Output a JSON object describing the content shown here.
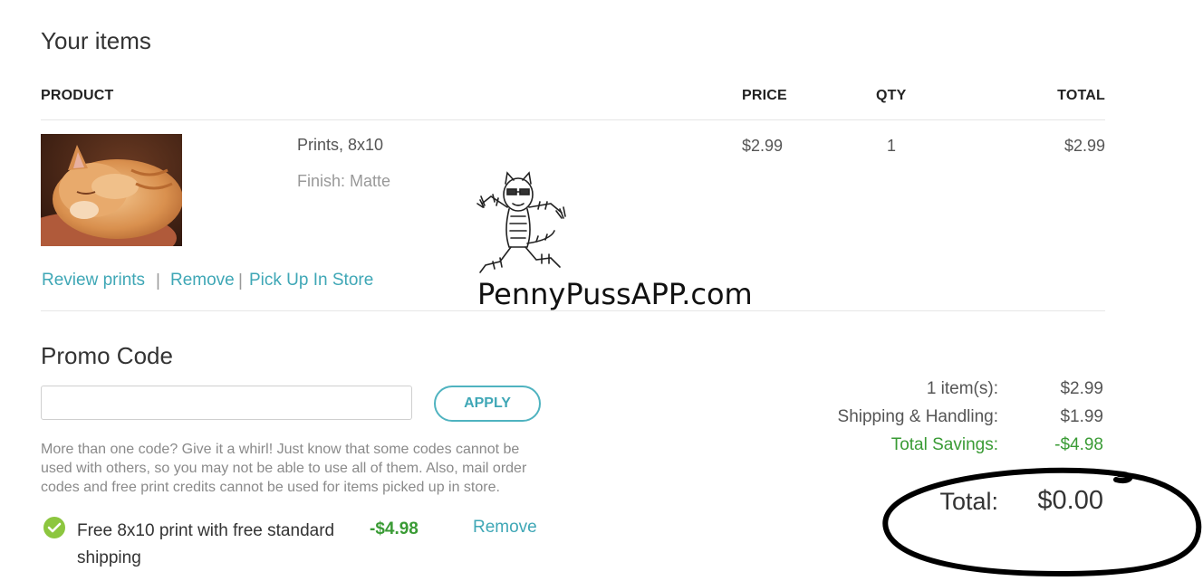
{
  "cart": {
    "title": "Your items",
    "columns": {
      "product": "PRODUCT",
      "price": "PRICE",
      "qty": "QTY",
      "total": "TOTAL"
    },
    "items": [
      {
        "name": "Prints, 8x10",
        "finish": "Finish: Matte",
        "price": "$2.99",
        "qty": "1",
        "total": "$2.99",
        "thumbnail": "orange-cat-photo"
      }
    ],
    "actions": {
      "review": "Review prints",
      "remove": "Remove",
      "pickup": "Pick Up In Store",
      "separator": "|"
    }
  },
  "watermark": {
    "text": "PennyPussAPP.com"
  },
  "promo": {
    "title": "Promo Code",
    "input_value": "",
    "input_placeholder": "",
    "apply_label": "APPLY",
    "note": "More than one code? Give it a whirl! Just know that some codes cannot be used with others, so you may not be able to use all of them. Also, mail order codes and free print credits cannot be used for items picked up in store.",
    "applied": [
      {
        "label": "Free 8x10 print with free standard shipping",
        "amount": "-$4.98",
        "remove_label": "Remove"
      }
    ]
  },
  "summary": {
    "items_label": "1 item(s):",
    "items_value": "$2.99",
    "shipping_label": "Shipping & Handling:",
    "shipping_value": "$1.99",
    "savings_label": "Total Savings:",
    "savings_value": "-$4.98",
    "total_label": "Total:",
    "total_value": "$0.00"
  },
  "colors": {
    "accent": "#3fa7b6",
    "savings": "#3a9b35",
    "text": "#333333",
    "muted": "#999999"
  }
}
